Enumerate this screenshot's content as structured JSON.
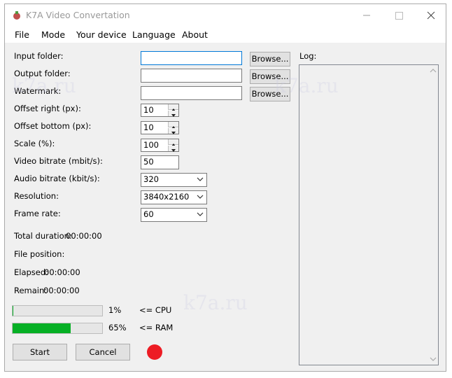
{
  "window": {
    "title": "K7A Video Convertation"
  },
  "menu": [
    "File",
    "Mode",
    "Your device",
    "Language",
    "About"
  ],
  "form": {
    "input_folder": {
      "label": "Input folder:",
      "value": "",
      "browse": "Browse..."
    },
    "output_folder": {
      "label": "Output folder:",
      "value": "",
      "browse": "Browse..."
    },
    "watermark": {
      "label": "Watermark:",
      "value": "",
      "browse": "Browse..."
    },
    "offset_right": {
      "label": "Offset right (px):",
      "value": "10"
    },
    "offset_bottom": {
      "label": "Offset bottom (px):",
      "value": "10"
    },
    "scale": {
      "label": "Scale (%):",
      "value": "100"
    },
    "video_bitrate": {
      "label": "Video bitrate (mbit/s):",
      "value": "50"
    },
    "audio_bitrate": {
      "label": "Audio bitrate (kbit/s):",
      "value": "320"
    },
    "resolution": {
      "label": "Resolution:",
      "value": "3840x2160"
    },
    "frame_rate": {
      "label": "Frame rate:",
      "value": "60"
    }
  },
  "status": {
    "total_duration_label": "Total duration:",
    "total_duration": "00:00:00",
    "file_position_label": "File position:",
    "elapsed_label": "Elapsed:",
    "elapsed": "00:00:00",
    "remain_label": "Remain:",
    "remain": "00:00:00"
  },
  "meters": {
    "cpu": {
      "percent": 1,
      "text": "1%",
      "label": "<= CPU"
    },
    "ram": {
      "percent": 65,
      "text": "65%",
      "label": "<= RAM"
    }
  },
  "buttons": {
    "start": "Start",
    "cancel": "Cancel"
  },
  "log": {
    "label": "Log:"
  },
  "watermark_texts": [
    "k7a.ru",
    "k7a.ru",
    "k7a.ru"
  ],
  "colors": {
    "accent_focus": "#0078d7",
    "progress_fill": "#06b025",
    "status_dot": "#ed1c24"
  }
}
